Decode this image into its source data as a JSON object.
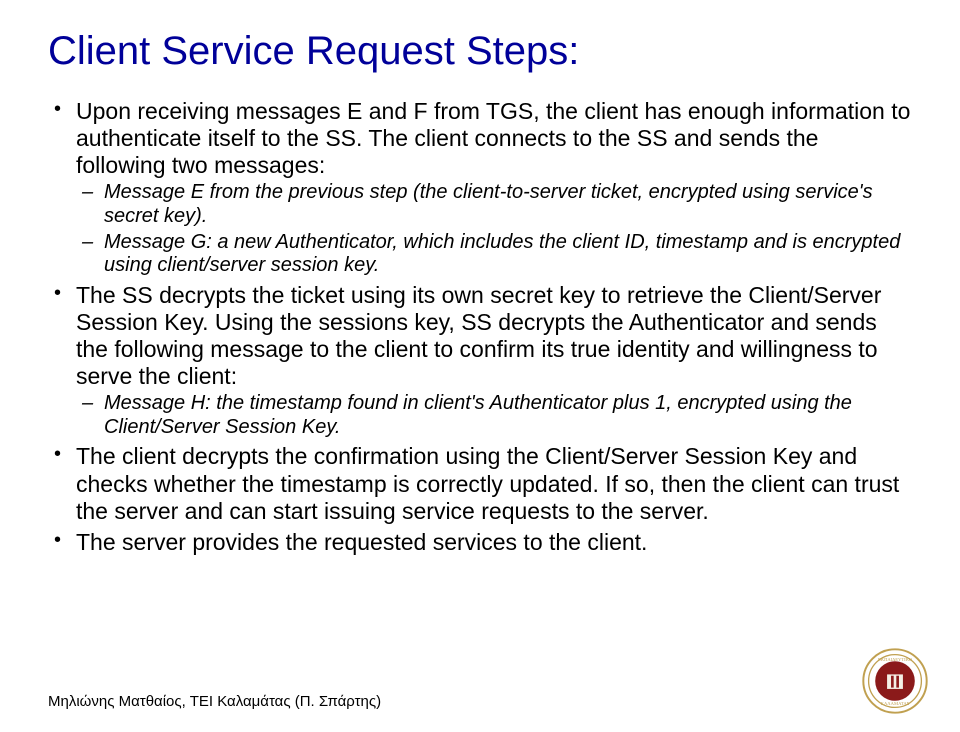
{
  "title": "Client Service Request Steps:",
  "bullets": {
    "b1": "Upon receiving messages E and F from TGS, the client has enough information to authenticate itself to the SS. The client connects to the SS and sends the following two messages:",
    "b1_sub": {
      "s1": "Message E from the previous step (the client-to-server ticket, encrypted using service's secret key).",
      "s2": "Message G: a new Authenticator, which includes the client ID, timestamp and is encrypted using client/server session key."
    },
    "b2": "The SS decrypts the ticket using its own secret key to retrieve the Client/Server Session Key. Using the sessions key, SS decrypts the Authenticator and sends the following message to the client to confirm its true identity and willingness to serve the client:",
    "b2_sub": {
      "s1": "Message H: the timestamp found in client's Authenticator plus 1, encrypted using the Client/Server Session Key."
    },
    "b3": "The client decrypts the confirmation using the Client/Server Session Key and checks whether the timestamp is correctly updated. If so, then the client can trust the server and can start issuing service requests to the server.",
    "b4": "The server provides the requested services to the client."
  },
  "footer": "Μηλιώνης Ματθαίος, ΤΕΙ Καλαμάτας (Π. Σπάρτης)",
  "logo_colors": {
    "outer": "#c0a050",
    "inner": "#8b1a1a",
    "text": "#ffffff"
  }
}
